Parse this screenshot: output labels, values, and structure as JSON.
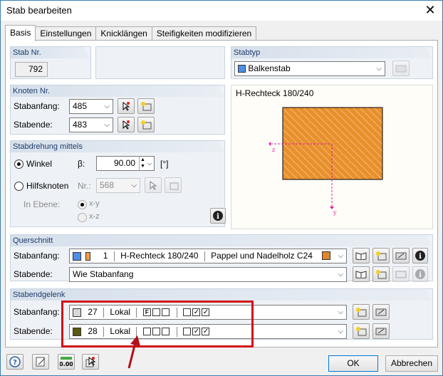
{
  "window": {
    "title": "Stab bearbeiten",
    "close": "✕"
  },
  "tabs": [
    "Basis",
    "Einstellungen",
    "Knicklängen",
    "Steifigkeiten modifizieren"
  ],
  "stab_nr": {
    "header": "Stab Nr.",
    "value": "792"
  },
  "stabtyp": {
    "header": "Stabtyp",
    "value": "Balkenstab",
    "swatch": "#4e8fe8"
  },
  "knoten": {
    "header": "Knoten Nr.",
    "start_label": "Stabanfang:",
    "start_value": "485",
    "end_label": "Stabende:",
    "end_value": "483"
  },
  "drehung": {
    "header": "Stabdrehung mittels",
    "winkel_label": "Winkel",
    "beta_label": "β:",
    "beta_value": "90.00",
    "unit": "[°]",
    "hilfs_label": "Hilfsknoten",
    "nr_label": "Nr.:",
    "nr_value": "568",
    "ebene_label": "In Ebene:",
    "xy": "x-y",
    "xz": "x-z"
  },
  "preview": {
    "title": "H-Rechteck 180/240",
    "z_label": "z",
    "y_label": "y",
    "fill": "#e8902c"
  },
  "querschnitt": {
    "header": "Querschnitt",
    "start_label": "Stabanfang:",
    "start_num": "1",
    "start_name": "H-Rechteck 180/240",
    "start_material": "Pappel und Nadelholz C24",
    "end_label": "Stabende:",
    "end_value": "Wie Stabanfang",
    "color_a": "#4e8fe8",
    "color_b": "#f0a050",
    "color_mat": "#e0862a"
  },
  "gelenk": {
    "header": "Stabendgelenk",
    "start_label": "Stabanfang:",
    "start_num": "27",
    "start_type": "Lokal",
    "start_color": "#d8d8d8",
    "start_f": "F",
    "end_label": "Stabende:",
    "end_num": "28",
    "end_type": "Lokal",
    "end_color": "#5a5a10",
    "check": "✓"
  },
  "footer": {
    "ok": "OK",
    "cancel": "Abbrechen"
  }
}
